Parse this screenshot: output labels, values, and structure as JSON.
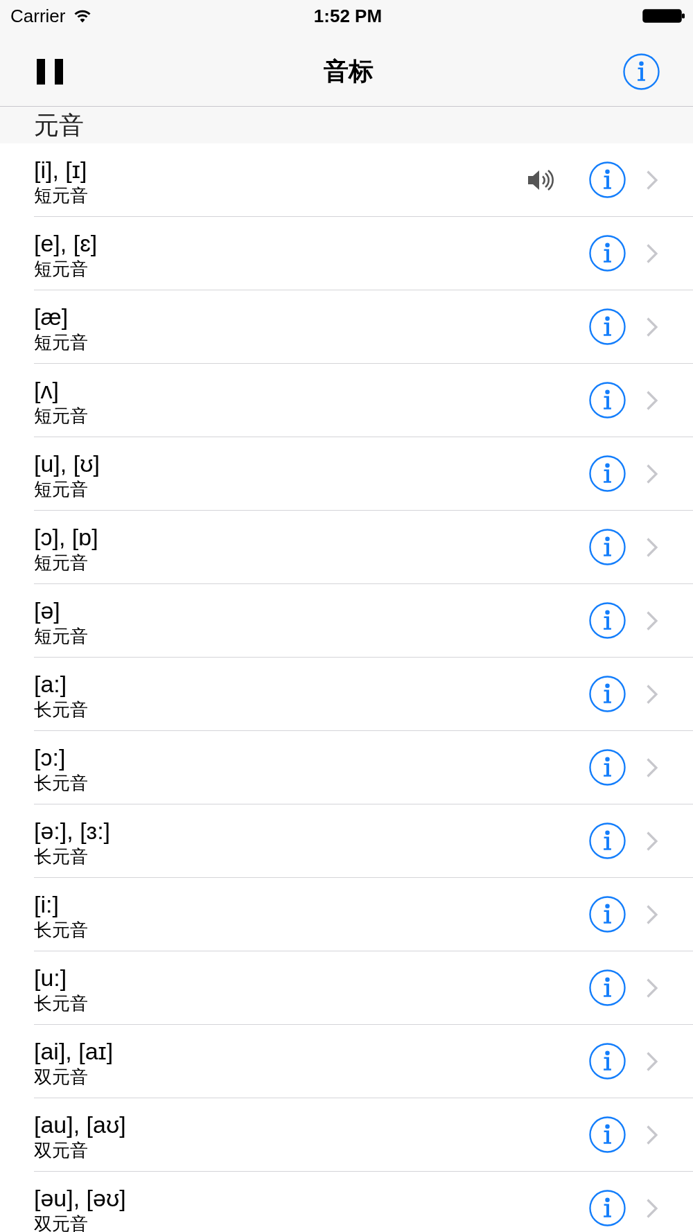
{
  "status_bar": {
    "carrier": "Carrier",
    "time": "1:52 PM"
  },
  "nav_bar": {
    "title": "音标"
  },
  "section": {
    "title": "元音"
  },
  "rows": [
    {
      "symbol": "[i], [ɪ]",
      "category": "短元音",
      "playing": true
    },
    {
      "symbol": "[e], [ɛ]",
      "category": "短元音",
      "playing": false
    },
    {
      "symbol": "[æ]",
      "category": "短元音",
      "playing": false
    },
    {
      "symbol": "[ʌ]",
      "category": "短元音",
      "playing": false
    },
    {
      "symbol": "[u], [ʊ]",
      "category": "短元音",
      "playing": false
    },
    {
      "symbol": "[ɔ], [ɒ]",
      "category": "短元音",
      "playing": false
    },
    {
      "symbol": "[ə]",
      "category": "短元音",
      "playing": false
    },
    {
      "symbol": "[a:]",
      "category": "长元音",
      "playing": false
    },
    {
      "symbol": "[ɔ:]",
      "category": "长元音",
      "playing": false
    },
    {
      "symbol": "[ə:], [ɜ:]",
      "category": "长元音",
      "playing": false
    },
    {
      "symbol": "[i:]",
      "category": "长元音",
      "playing": false
    },
    {
      "symbol": "[u:]",
      "category": "长元音",
      "playing": false
    },
    {
      "symbol": "[ai], [aɪ]",
      "category": "双元音",
      "playing": false
    },
    {
      "symbol": "[au], [aʊ]",
      "category": "双元音",
      "playing": false
    },
    {
      "symbol": "[əu], [əʊ]",
      "category": "双元音",
      "playing": false
    }
  ]
}
